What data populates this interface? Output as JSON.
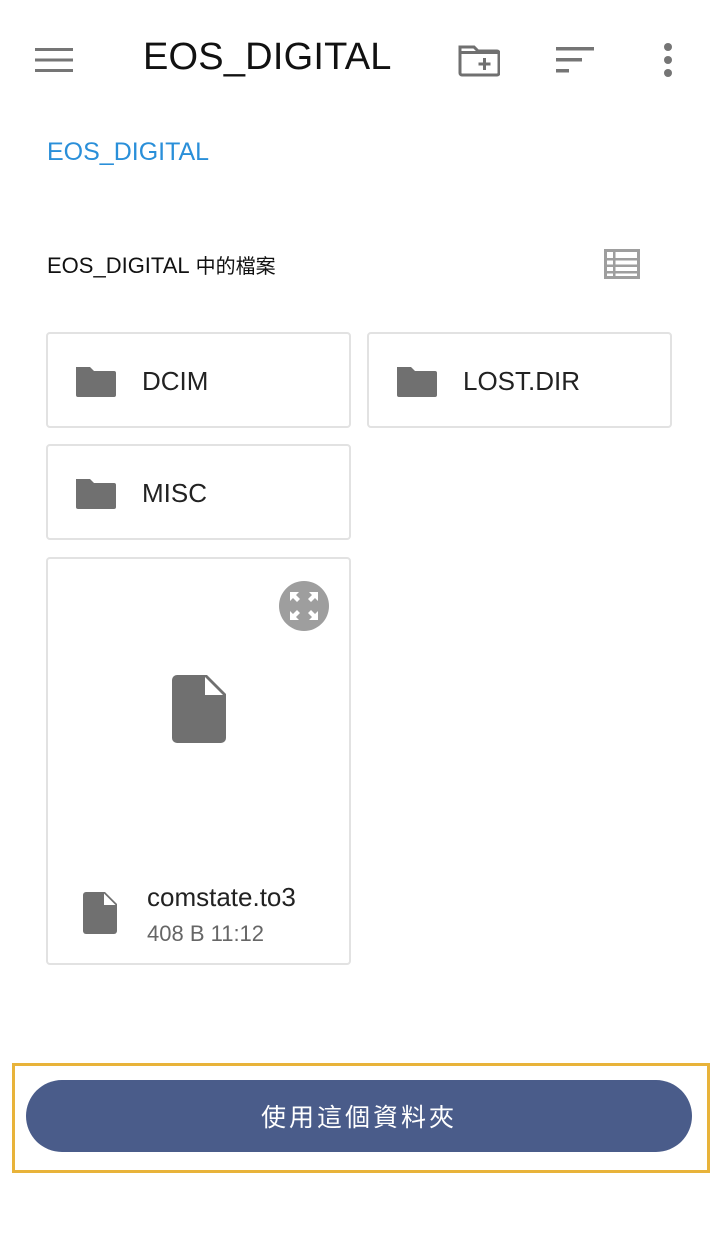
{
  "header": {
    "title": "EOS_DIGITAL",
    "icons": {
      "menu": "hamburger-icon",
      "new_folder": "create-folder-icon",
      "sort": "sort-icon",
      "more": "more-vert-icon"
    }
  },
  "breadcrumb": "EOS_DIGITAL",
  "section": {
    "title_main": "EOS_DIGITAL",
    "title_suffix": "中的檔案",
    "view_icon": "list-view-icon"
  },
  "folders": [
    {
      "name": "DCIM",
      "icon": "folder-icon"
    },
    {
      "name": "LOST.DIR",
      "icon": "folder-icon"
    },
    {
      "name": "MISC",
      "icon": "folder-icon"
    }
  ],
  "files": [
    {
      "name": "comstate.to3",
      "size": "408 B",
      "time": "11:12",
      "meta": "408 B  11:12",
      "icon": "file-icon"
    }
  ],
  "action_button": {
    "label": "使用這個資料夾"
  },
  "colors": {
    "accent": "#2a8fd9",
    "button": "#4a5c8a",
    "highlight": "#e8b33a",
    "icon_gray": "#707070"
  }
}
